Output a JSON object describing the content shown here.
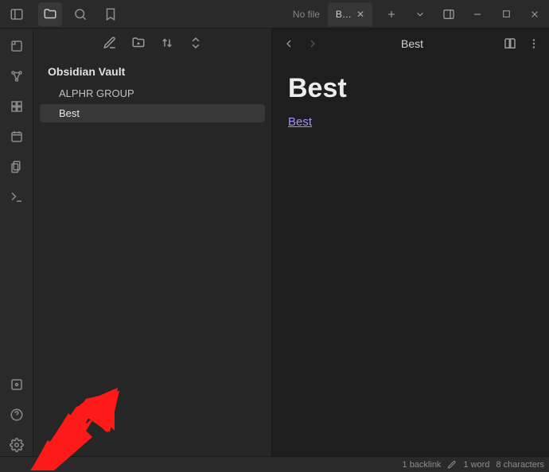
{
  "titlebar": {
    "tabs": [
      {
        "label": "No file",
        "active": false
      },
      {
        "label": "B…",
        "active": true
      }
    ]
  },
  "sidebar": {
    "vault": "Obsidian Vault",
    "items": [
      {
        "label": "ALPHR GROUP",
        "type": "folder",
        "selected": false
      },
      {
        "label": "Best",
        "type": "file",
        "selected": true
      }
    ]
  },
  "editor": {
    "breadcrumb": "Best",
    "title": "Best",
    "link_text": "Best"
  },
  "statusbar": {
    "backlinks": "1 backlink",
    "words": "1 word",
    "characters": "8 characters"
  }
}
